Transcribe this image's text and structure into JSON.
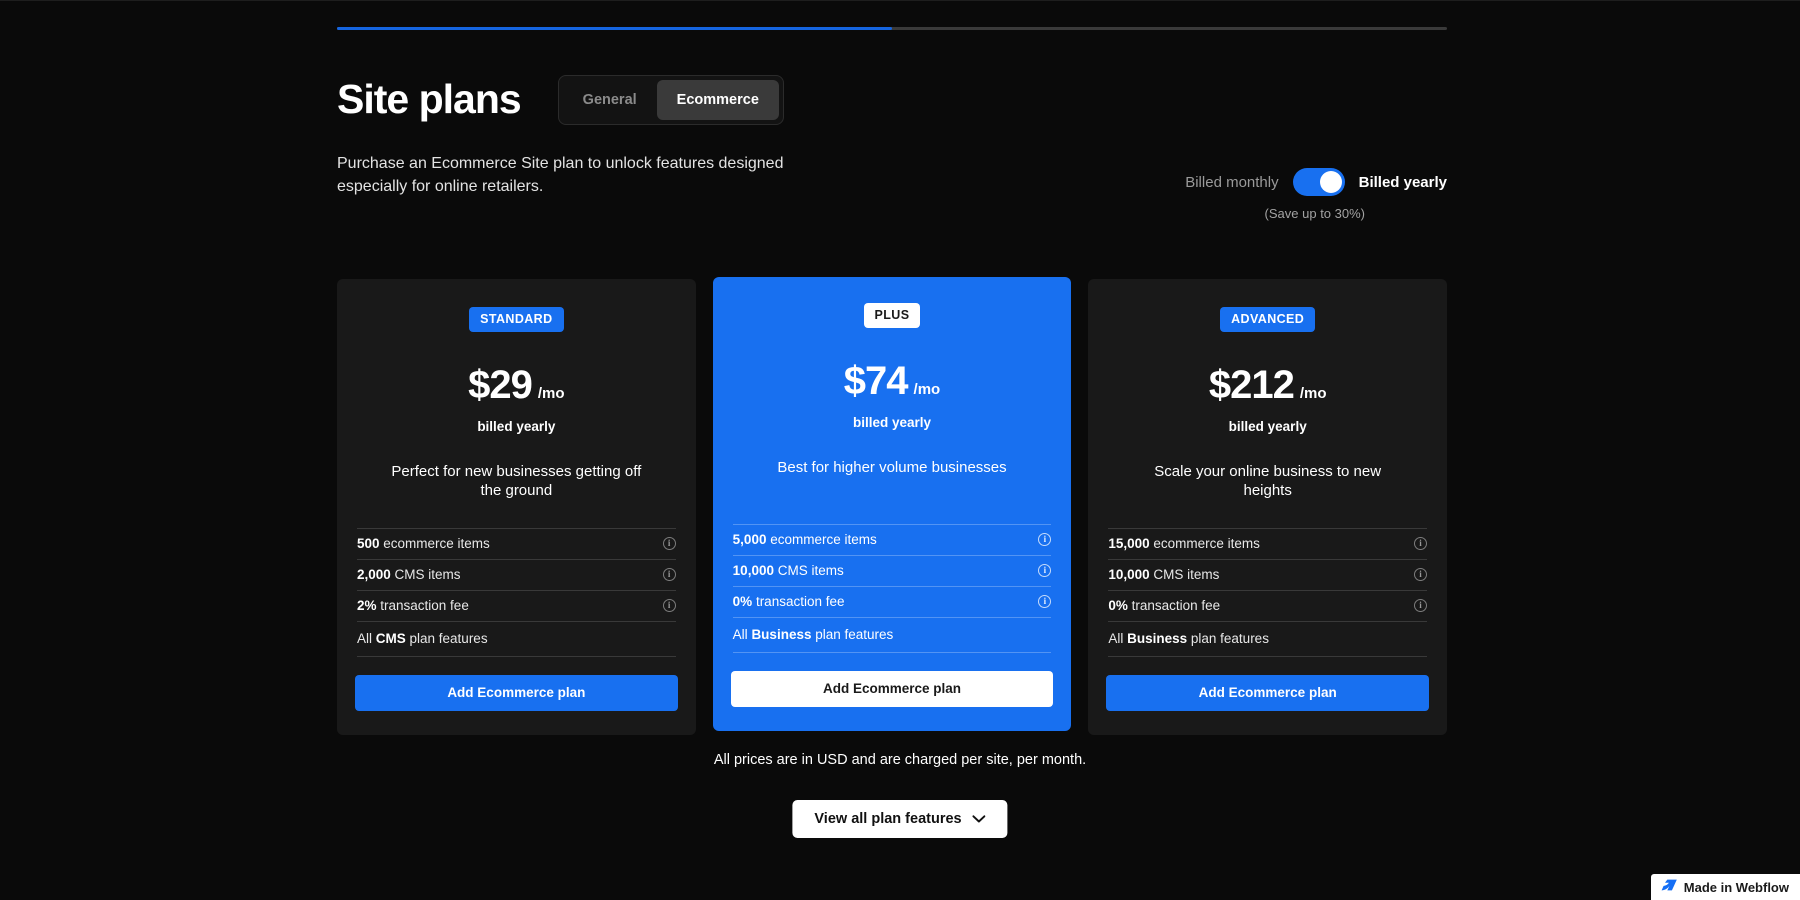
{
  "colors": {
    "page_bg": "#0a0a0a",
    "card_bg": "#191919",
    "accent_blue": "#1870f0",
    "progress_fill": "#1565e0"
  },
  "progress": {
    "percent": 50
  },
  "header": {
    "title": "Site plans",
    "subtitle": "Purchase an Ecommerce Site plan to unlock features designed especially for online retailers.",
    "tabs": [
      {
        "label": "General",
        "active": false
      },
      {
        "label": "Ecommerce",
        "active": true
      }
    ]
  },
  "billing": {
    "monthly_label": "Billed monthly",
    "yearly_label": "Billed yearly",
    "note": "(Save up to 30%)",
    "toggle_state": "yearly"
  },
  "plans": [
    {
      "badge": "STANDARD",
      "badge_style": "blue",
      "price": "$29",
      "period": "/mo",
      "billed": "billed yearly",
      "description": "Perfect for new businesses getting off the ground",
      "features": [
        {
          "value": "500",
          "text": "ecommerce items",
          "info": true
        },
        {
          "value": "2,000",
          "text": "CMS items",
          "info": true
        },
        {
          "value": "2%",
          "text": "transaction fee",
          "info": true
        }
      ],
      "plan_features_prefix": "All ",
      "plan_features_bold": "CMS",
      "plan_features_suffix": " plan features",
      "cta": "Add Ecommerce plan",
      "cta_style": "blue",
      "featured": false
    },
    {
      "badge": "PLUS",
      "badge_style": "light",
      "price": "$74",
      "period": "/mo",
      "billed": "billed yearly",
      "description": "Best for higher volume businesses",
      "features": [
        {
          "value": "5,000",
          "text": "ecommerce items",
          "info": true
        },
        {
          "value": "10,000",
          "text": "CMS items",
          "info": true
        },
        {
          "value": "0%",
          "text": "transaction fee",
          "info": true
        }
      ],
      "plan_features_prefix": "All ",
      "plan_features_bold": "Business",
      "plan_features_suffix": " plan features",
      "cta": "Add Ecommerce plan",
      "cta_style": "light",
      "featured": true
    },
    {
      "badge": "ADVANCED",
      "badge_style": "blue",
      "price": "$212",
      "period": "/mo",
      "billed": "billed yearly",
      "description": "Scale your online business to new heights",
      "features": [
        {
          "value": "15,000",
          "text": "ecommerce items",
          "info": true
        },
        {
          "value": "10,000",
          "text": "CMS items",
          "info": true
        },
        {
          "value": "0%",
          "text": "transaction fee",
          "info": true
        }
      ],
      "plan_features_prefix": "All ",
      "plan_features_bold": "Business",
      "plan_features_suffix": " plan features",
      "cta": "Add Ecommerce plan",
      "cta_style": "blue",
      "featured": false
    }
  ],
  "footer": {
    "note": "All prices are in USD and are charged per site, per month.",
    "view_all_label": "View all plan features",
    "info_glyph": "i"
  },
  "webflow_badge": {
    "label": "Made in Webflow"
  }
}
